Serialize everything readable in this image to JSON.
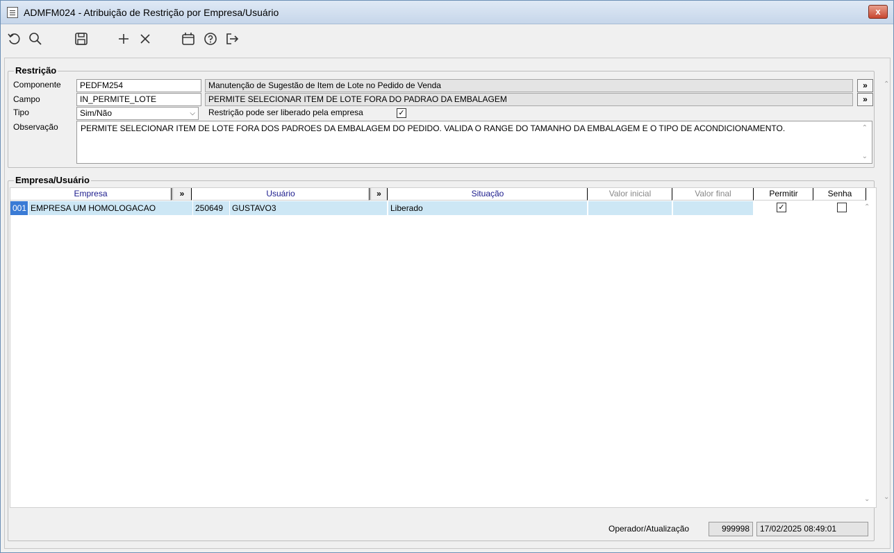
{
  "window": {
    "title": "ADMFM024 - Atribuição de Restrição por Empresa/Usuário",
    "close": "x"
  },
  "toolbar": {
    "undo": "↺",
    "search": "🔍",
    "save": "💾",
    "add": "+",
    "delete": "×",
    "calendar": "📅",
    "help": "?",
    "exit": "↦"
  },
  "restricao": {
    "title": "Restrição",
    "componente_label": "Componente",
    "componente_code": "PEDFM254",
    "componente_desc": "Manutenção de Sugestão de Item de Lote no Pedido de Venda",
    "campo_label": "Campo",
    "campo_code": "IN_PERMITE_LOTE",
    "campo_desc": "PERMITE SELECIONAR ITEM DE LOTE FORA DO PADRAO DA EMBALAGEM",
    "tipo_label": "Tipo",
    "tipo_value": "Sim/Não",
    "liberado_label": "Restrição pode ser liberado pela empresa",
    "liberado_checked": "✓",
    "obs_label": "Observação",
    "obs_value": "PERMITE SELECIONAR ITEM DE LOTE FORA DOS PADROES DA EMBALAGEM DO PEDIDO. VALIDA O RANGE DO TAMANHO DA EMBALAGEM E O TIPO DE ACONDICIONAMENTO.",
    "btn_more": "»"
  },
  "empresa_usuario": {
    "title": "Empresa/Usuário",
    "columns": {
      "empresa": "Empresa",
      "usuario": "Usuário",
      "situacao": "Situação",
      "valor_inicial": "Valor inicial",
      "valor_final": "Valor final",
      "permitir": "Permitir",
      "senha": "Senha",
      "more": "»"
    },
    "rows": [
      {
        "empresa_code": "001",
        "empresa_name": "EMPRESA UM HOMOLOGACAO",
        "usuario_code": "250649",
        "usuario_name": "GUSTAVO3",
        "situacao": "Liberado",
        "valor_inicial": "",
        "valor_final": "",
        "permitir": "✓",
        "senha": ""
      }
    ]
  },
  "footer": {
    "label": "Operador/Atualização",
    "operador": "999998",
    "data": "17/02/2025 08:49:01"
  }
}
